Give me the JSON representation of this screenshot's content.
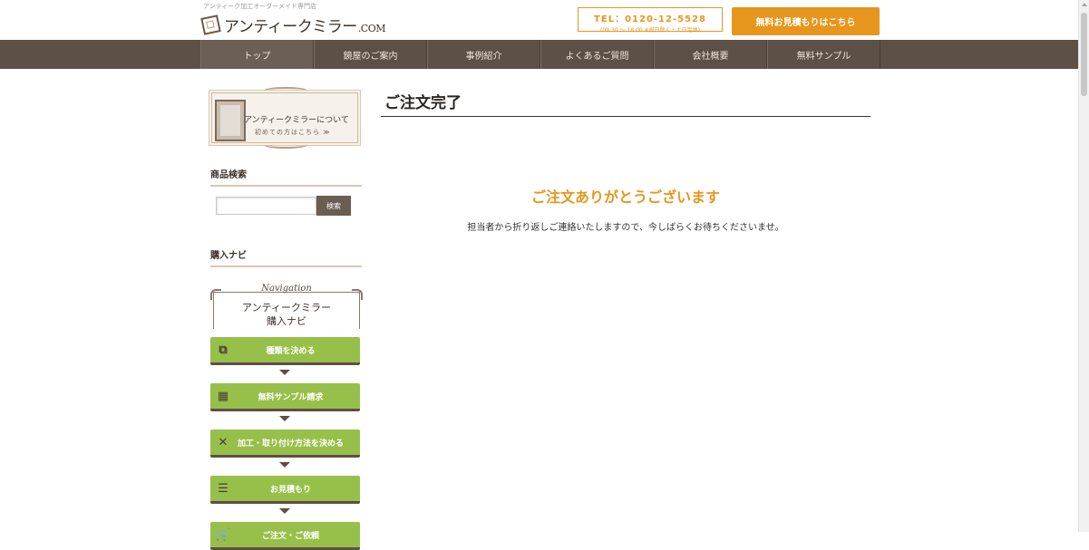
{
  "header": {
    "tagline": "アンティーク加工オーダーメイド専門店",
    "logo_main": "アンティークミラー",
    "logo_suffix": ".COM",
    "tel_number": "TEL：0120-12-5528",
    "tel_hours": "(09:30 ～ 18:00 ※祝日除く・土日定休)",
    "estimate_button": "無料お見積もりはこちら"
  },
  "nav": {
    "items": [
      {
        "label": "トップ"
      },
      {
        "label": "鏡屋のご案内"
      },
      {
        "label": "事例紹介"
      },
      {
        "label": "よくあるご質問"
      },
      {
        "label": "会社概要"
      },
      {
        "label": "無料サンプル"
      }
    ]
  },
  "sidebar": {
    "about_title": "アンティークミラーについて",
    "about_sub": "初めての方はこちら ≫",
    "search_heading": "商品検索",
    "search_placeholder": "",
    "search_button": "検索",
    "navi_heading": "購入ナビ",
    "navi_script": "Navigation",
    "navi_title_line1": "アンティークミラー",
    "navi_title_line2": "購入ナビ",
    "steps": [
      {
        "label": "種類を決める",
        "icon": "copy-icon"
      },
      {
        "label": "無料サンプル請求",
        "icon": "samples-icon"
      },
      {
        "label": "加工・取り付け方法を決める",
        "icon": "tools-icon"
      },
      {
        "label": "お見積もり",
        "icon": "list-icon"
      },
      {
        "label": "ご注文・ご依頼",
        "icon": "cart-icon"
      }
    ]
  },
  "main": {
    "page_title": "ご注文完了",
    "thanks_heading": "ご注文ありがとうございます",
    "thanks_body": "担当者から折り返しご連絡いたしますので、今しばらくお待ちくださいませ。"
  },
  "colors": {
    "accent": "#e7961d",
    "nav_bg": "#5c5047",
    "step_green": "#97c04b"
  }
}
